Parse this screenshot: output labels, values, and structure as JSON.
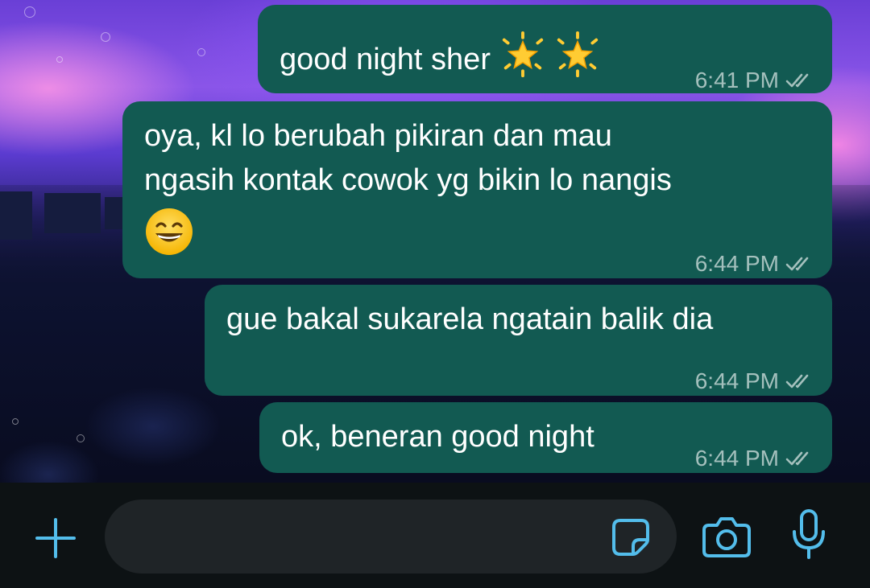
{
  "colors": {
    "outgoing_bubble": "#125a52",
    "accent_icon": "#53bdeb",
    "input_bar_bg": "#0d1214",
    "input_field_bg": "#1f2427"
  },
  "messages": [
    {
      "text": "good night sher",
      "emoji": [
        "glowing-star",
        "glowing-star"
      ],
      "time": "6:41 PM",
      "status": "read-double-tick"
    },
    {
      "line1": "oya, kl lo berubah pikiran dan mau",
      "line2": "ngasih kontak cowok yg bikin lo nangis",
      "emoji": [
        "grinning-face-with-smiling-eyes"
      ],
      "time": "6:44 PM",
      "status": "read-double-tick"
    },
    {
      "text": "gue bakal sukarela ngatain balik dia",
      "time": "6:44 PM",
      "status": "read-double-tick"
    },
    {
      "text": "ok, beneran good night",
      "time": "6:44 PM",
      "status": "read-double-tick"
    }
  ],
  "input_bar": {
    "placeholder": "",
    "value": "",
    "icons": [
      "plus-icon",
      "sticker-icon",
      "camera-icon",
      "microphone-icon"
    ]
  }
}
